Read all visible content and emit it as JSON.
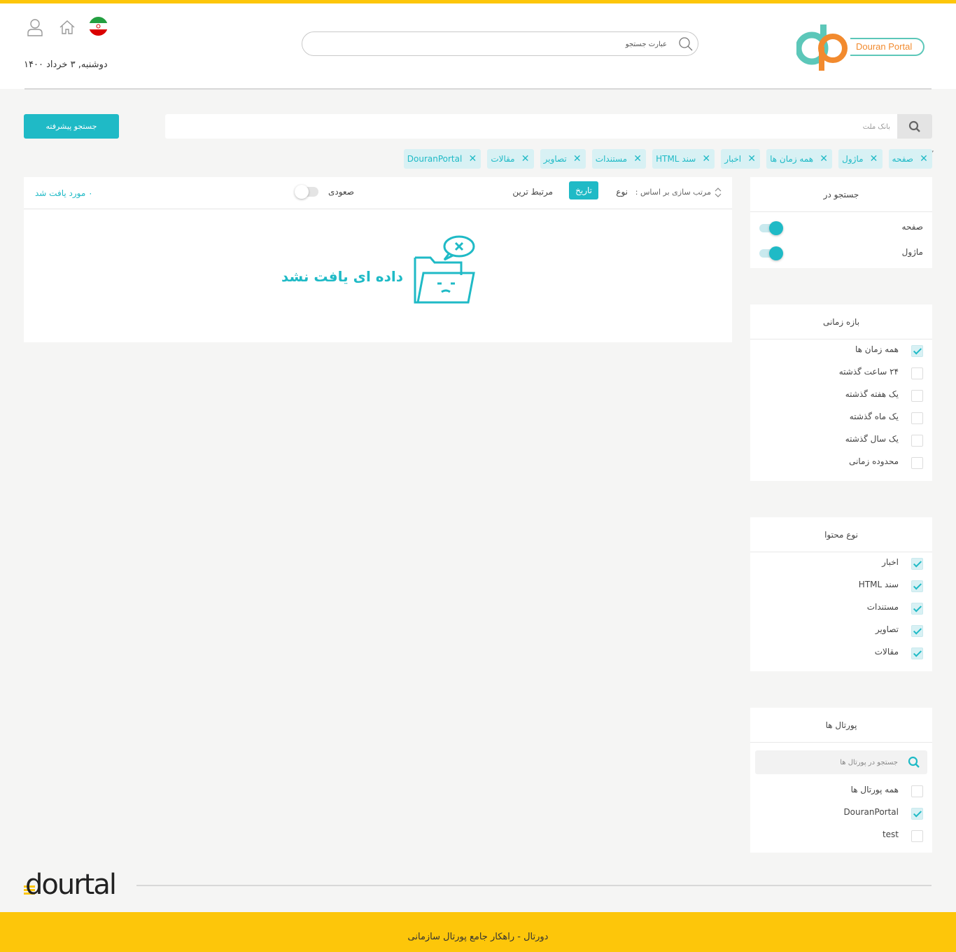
{
  "colors": {
    "accent": "#1fbac6",
    "brand_yellow": "#fdc60a",
    "chip_bg": "#d8f1f4",
    "logo_teal": "#5cc7b9",
    "logo_orange": "#f28a2e"
  },
  "header": {
    "logo_text": "Douran Portal",
    "search_placeholder": "عبارت جستجو",
    "date": "دوشنبه, ۳ خرداد ۱۴۰۰",
    "icons": [
      "iran-flag-icon",
      "home-icon",
      "user-icon"
    ]
  },
  "search": {
    "value_placeholder": "بانک ملت",
    "advanced_button": "جستجو پیشرفته"
  },
  "chips": [
    "صفحه",
    "ماژول",
    "همه زمان ها",
    "اخبار",
    "سند HTML",
    "مستندات",
    "تصاویر",
    "مقالات",
    "DouranPortal"
  ],
  "results": {
    "sort_label": "مرتب سازی بر اساس :",
    "sort_options": [
      "نوع",
      "تاریخ",
      "مرتبط ترین"
    ],
    "sort_active": "تاریخ",
    "ascending_label": "صعودی",
    "ascending_on": false,
    "count_text": "۰ مورد یافت شد",
    "empty_text": "داده ای یافت نشد"
  },
  "panels": {
    "search_in": {
      "title": "جستجو در",
      "items": [
        {
          "label": "صفحه",
          "on": true
        },
        {
          "label": "ماژول",
          "on": true
        }
      ]
    },
    "time_range": {
      "title": "بازه زمانی",
      "items": [
        {
          "label": "همه زمان ها",
          "checked": true
        },
        {
          "label": "۲۴ ساعت گذشته",
          "checked": false
        },
        {
          "label": "یک هفته گذشته",
          "checked": false
        },
        {
          "label": "یک ماه گذشته",
          "checked": false
        },
        {
          "label": "یک سال گذشته",
          "checked": false
        },
        {
          "label": "محدوده زمانی",
          "checked": false
        }
      ]
    },
    "content_type": {
      "title": "نوع محتوا",
      "items": [
        {
          "label": "اخبار",
          "checked": true
        },
        {
          "label": "سند HTML",
          "checked": true
        },
        {
          "label": "مستندات",
          "checked": true
        },
        {
          "label": "تصاویر",
          "checked": true
        },
        {
          "label": "مقالات",
          "checked": true
        }
      ]
    },
    "portals": {
      "title": "پورتال ها",
      "search_placeholder": "جستجو در پورتال ها",
      "items": [
        {
          "label": "همه پورتال ها",
          "checked": false
        },
        {
          "label": "DouranPortal",
          "checked": true
        },
        {
          "label": "test",
          "checked": false
        }
      ]
    }
  },
  "footer": {
    "brand": "dourtal",
    "text": "دورتال - راهکار جامع پورتال سازمانی"
  }
}
